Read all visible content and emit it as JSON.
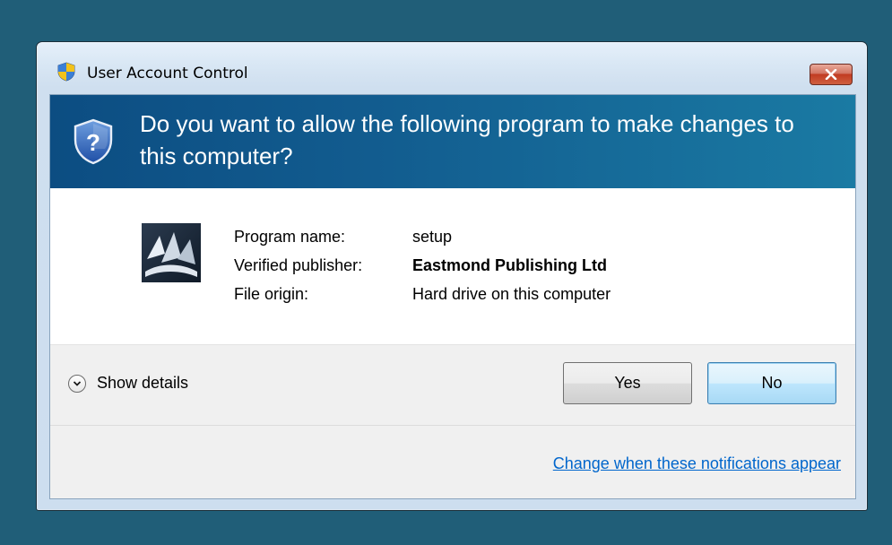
{
  "window": {
    "title": "User Account Control",
    "title_icon": "uac-shield-icon",
    "close_icon": "close-icon"
  },
  "banner": {
    "question": "Do you want to allow the following program to make changes to this computer?",
    "icon": "uac-question-shield-icon"
  },
  "program": {
    "icon": "program-icon",
    "rows": [
      {
        "label": "Program name:",
        "value": "setup"
      },
      {
        "label": "Verified publisher:",
        "value": "Eastmond Publishing Ltd"
      },
      {
        "label": "File origin:",
        "value": "Hard drive on this computer"
      }
    ]
  },
  "actions": {
    "show_details": "Show details",
    "yes": "Yes",
    "no": "No",
    "change_link": "Change when these notifications appear"
  },
  "colors": {
    "desktop": "#205e78",
    "banner": "#125c8f",
    "link": "#0066cc",
    "close_button": "#c13b22"
  }
}
